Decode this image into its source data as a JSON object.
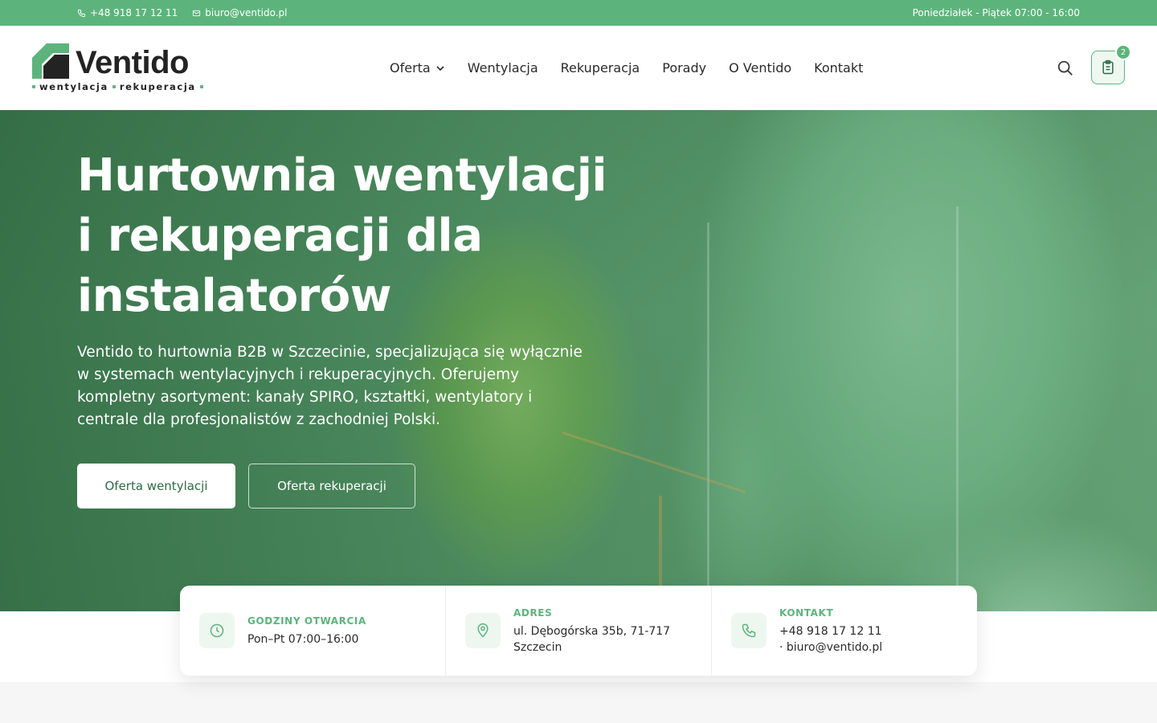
{
  "colors": {
    "brand_green": "#5cb47c",
    "text_dark": "#232323",
    "white": "#ffffff"
  },
  "topbar": {
    "phone": "+48 918 17 12 11",
    "email": "biuro@ventido.pl",
    "hours": "Poniedziałek - Piątek 07:00 - 16:00",
    "icons": {
      "phone": "phone-icon",
      "email": "mail-icon"
    }
  },
  "header": {
    "logo": {
      "wordmark": "Ventido",
      "tagline_1": "wentylacja",
      "tagline_2": "rekuperacja"
    },
    "nav": [
      {
        "label": "Oferta",
        "has_dropdown": true
      },
      {
        "label": "Wentylacja"
      },
      {
        "label": "Rekuperacja"
      },
      {
        "label": "Porady"
      },
      {
        "label": "O Ventido"
      },
      {
        "label": "Kontakt"
      }
    ],
    "icons": {
      "search": "search-icon",
      "cart": "clipboard-icon"
    },
    "cart_count": "2"
  },
  "hero": {
    "title_lines": [
      "Hurtownia wentylacji",
      "i rekuperacji dla",
      "instalatorów"
    ],
    "description_lines": [
      "Ventido to hurtownia B2B w Szczecinie, specjalizująca się wyłącznie",
      "w systemach wentylacyjnych i rekuperacyjnych. Oferujemy",
      "kompletny asortyment: kanały SPIRO, kształtki, wentylatory i",
      "centrale dla profesjonalistów z zachodniej Polski."
    ],
    "primary_button": "Oferta wentylacji",
    "secondary_button": "Oferta rekuperacji"
  },
  "info": [
    {
      "icon": "clock-icon",
      "label": "GODZINY OTWARCIA",
      "value": "Pon–Pt 07:00–16:00"
    },
    {
      "icon": "map-pin-icon",
      "label": "ADRES",
      "value": "ul. Dębogórska 35b, 71-717 Szczecin"
    },
    {
      "icon": "phone-icon",
      "label": "KONTAKT",
      "value": "+48 918 17 12 11 · biuro@ventido.pl"
    }
  ]
}
